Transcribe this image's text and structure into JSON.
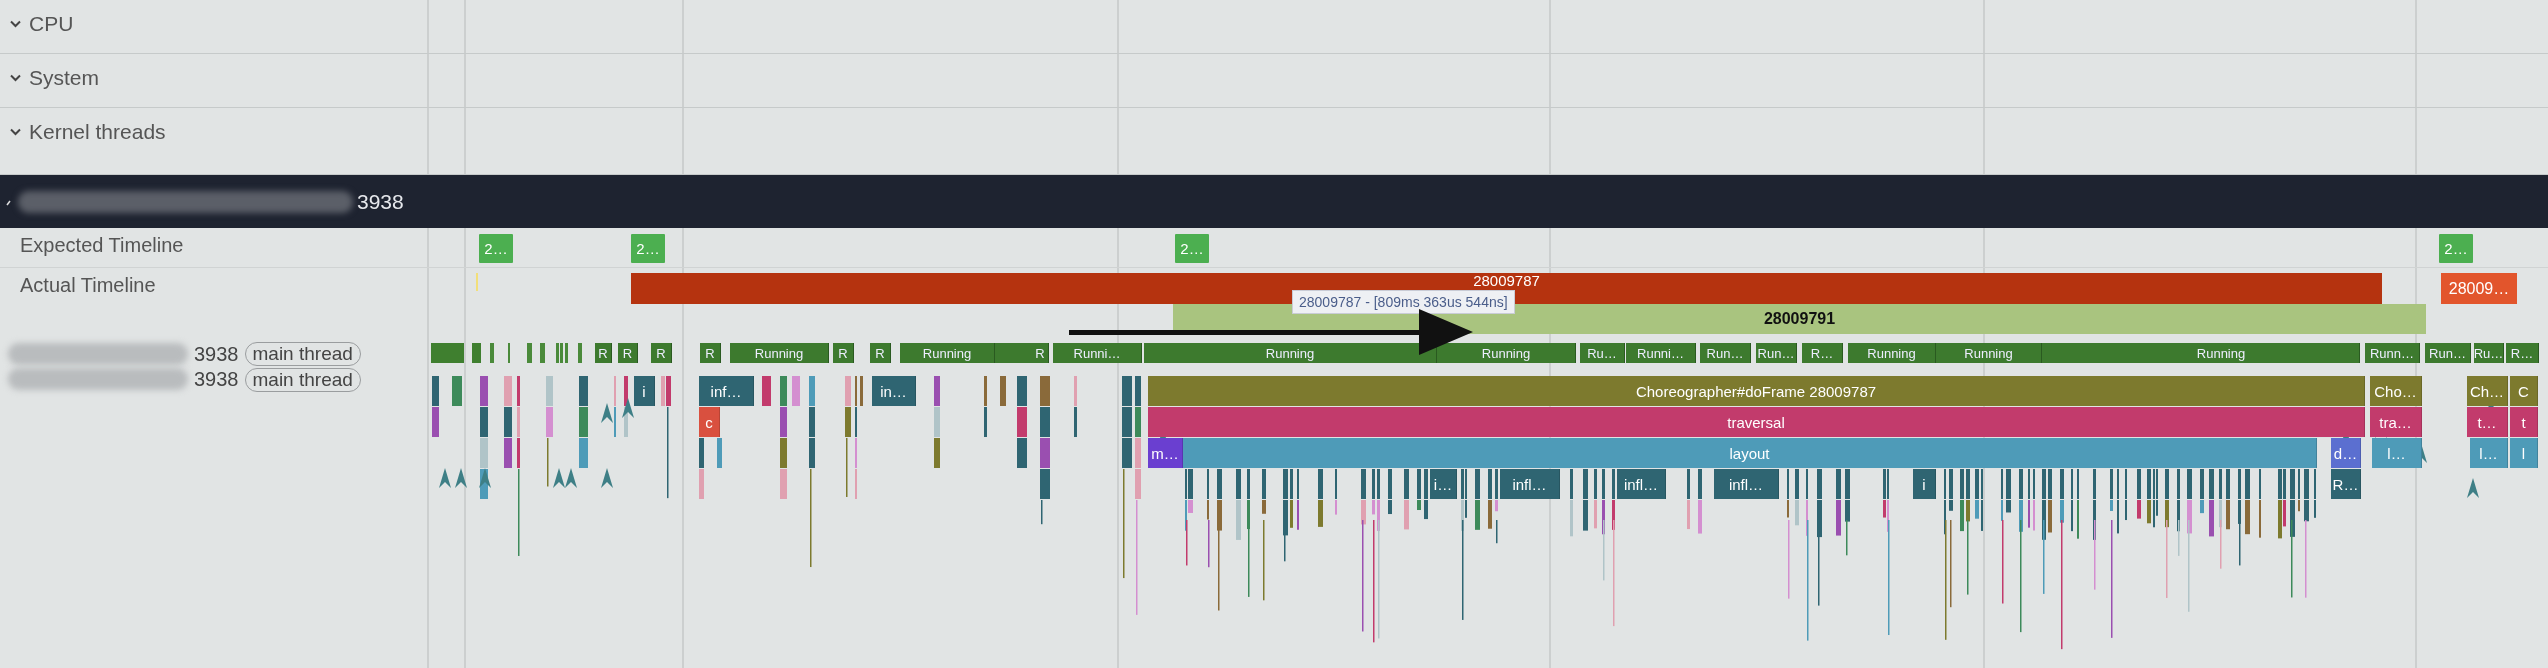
{
  "track_groups": [
    {
      "label": "CPU"
    },
    {
      "label": "System"
    },
    {
      "label": "Kernel threads"
    }
  ],
  "process": {
    "name": "3938"
  },
  "expected_timeline": {
    "label": "Expected Timeline",
    "slices": [
      {
        "label": "2…",
        "color": "#4caf50"
      },
      {
        "label": "2…",
        "color": "#4caf50"
      },
      {
        "label": "2…",
        "color": "#4caf50"
      },
      {
        "label": "2…",
        "color": "#4caf50"
      }
    ]
  },
  "actual_timeline": {
    "label": "Actual Timeline",
    "slices": [
      {
        "label": "28009787",
        "color": "#b5330f"
      },
      {
        "label": "28009791",
        "color": "#a9c47f"
      },
      {
        "label": "28009…",
        "color": "#e2552c"
      }
    ]
  },
  "tooltip": {
    "text": "28009787 - [809ms 363us 544ns]"
  },
  "threads": [
    {
      "name": "3938",
      "tag": "main thread",
      "kind": "states",
      "slices": [
        {
          "label": "R"
        },
        {
          "label": "R"
        },
        {
          "label": "R"
        },
        {
          "label": "R"
        },
        {
          "label": "Running"
        },
        {
          "label": "R"
        },
        {
          "label": "R"
        },
        {
          "label": "Running"
        },
        {
          "label": "R"
        },
        {
          "label": "Runni…"
        },
        {
          "label": "Running"
        },
        {
          "label": "Running"
        },
        {
          "label": "Ru…"
        },
        {
          "label": "Runni…"
        },
        {
          "label": "Run…"
        },
        {
          "label": "Run…"
        },
        {
          "label": "R…"
        },
        {
          "label": "Running"
        },
        {
          "label": "Running"
        },
        {
          "label": "Running"
        },
        {
          "label": "Runn…"
        },
        {
          "label": "Run…"
        },
        {
          "label": "Ru…"
        },
        {
          "label": "R…"
        }
      ]
    },
    {
      "name": "3938",
      "tag": "main thread",
      "kind": "slices",
      "slices": [
        {
          "label": "i",
          "color": "#2f6572"
        },
        {
          "label": "inf…",
          "color": "#2f6572"
        },
        {
          "label": "c",
          "color": "#d9503f"
        },
        {
          "label": "in…",
          "color": "#2f6572"
        },
        {
          "label": "Choreographer#doFrame 28009787",
          "color": "#7d7a2e"
        },
        {
          "label": "traversal",
          "color": "#c23b6c"
        },
        {
          "label": "m…",
          "color": "#6a3fd0"
        },
        {
          "label": "layout",
          "color": "#4e9bb8"
        },
        {
          "label": "d…",
          "color": "#5b6fd0"
        },
        {
          "label": "i…",
          "color": "#2f6572"
        },
        {
          "label": "infl…",
          "color": "#2f6572"
        },
        {
          "label": "infl…",
          "color": "#2f6572"
        },
        {
          "label": "infl…",
          "color": "#2f6572"
        },
        {
          "label": "i",
          "color": "#2f6572"
        },
        {
          "label": "R…",
          "color": "#2f6572"
        },
        {
          "label": "Cho…",
          "color": "#7d7a2e"
        },
        {
          "label": "tra…",
          "color": "#c23b6c"
        },
        {
          "label": "l…",
          "color": "#4e9bb8"
        },
        {
          "label": "Ch…",
          "color": "#7d7a2e"
        },
        {
          "label": "t…",
          "color": "#c23b6c"
        },
        {
          "label": "l…",
          "color": "#4e9bb8"
        },
        {
          "label": "C",
          "color": "#7d7a2e"
        },
        {
          "label": "t",
          "color": "#c23b6c"
        },
        {
          "label": "l",
          "color": "#4e9bb8"
        }
      ]
    }
  ]
}
